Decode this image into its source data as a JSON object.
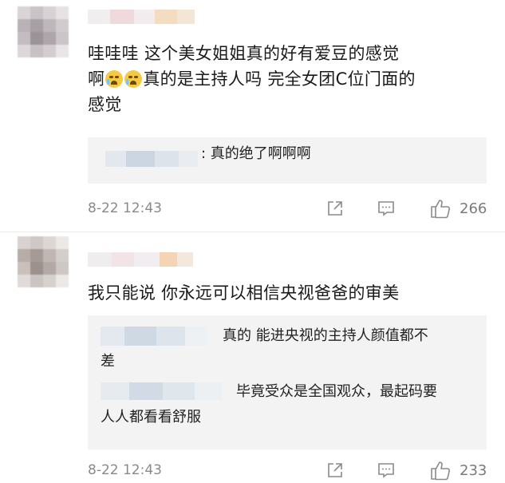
{
  "comments": [
    {
      "text_line1": "哇哇哇 这个美女姐姐真的好有爱豆的感觉",
      "text_line2_before": "啊",
      "text_line2_after": "真的是主持人吗 完全女团C位门面的",
      "text_line3": "感觉",
      "emoji": "crying-emoji",
      "replies": [
        {
          "text": ": 真的绝了啊啊啊"
        }
      ],
      "time": "8-22 12:43",
      "like_count": "266"
    },
    {
      "text_line1": "我只能说 你永远可以相信央视爸爸的审美",
      "replies": [
        {
          "text_line1": "真的 能进央视的主持人颜值都不",
          "text_line2": "差"
        },
        {
          "text_line1": "毕竟受众是全国观众，最起码要",
          "text_line2": "人人都看看舒服"
        }
      ],
      "time": "8-22 12:43",
      "like_count": "233"
    }
  ],
  "icons": {
    "share": "share-icon",
    "comment": "comment-icon",
    "like": "thumbs-up-icon"
  },
  "colors": {
    "text": "#1a1a1a",
    "meta": "#8a8a8a",
    "reply_bg": "#f3f3f3"
  }
}
